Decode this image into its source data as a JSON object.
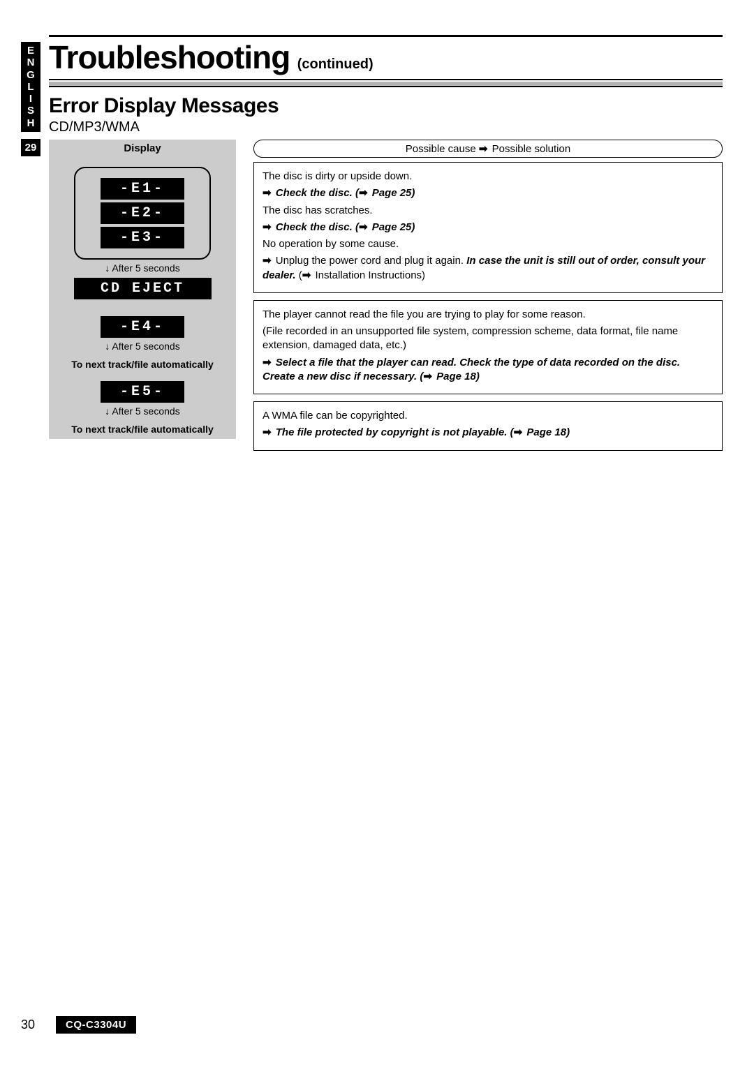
{
  "sidebar": {
    "language": "ENGLISH",
    "tab_page": "29"
  },
  "header": {
    "title": "Troubleshooting",
    "continued": "(continued)"
  },
  "section": {
    "heading": "Error Display Messages",
    "subtitle": "CD/MP3/WMA"
  },
  "left": {
    "header": "Display",
    "e1": "-E1-",
    "e2": "-E2-",
    "e3": "-E3-",
    "e4": "-E4-",
    "e5": "-E5-",
    "after5": "After 5 seconds",
    "cd_eject": "CD EJECT",
    "to_next": "To next track/file automatically"
  },
  "right": {
    "header_cause": "Possible cause",
    "header_sol": "Possible solution",
    "box1": {
      "l1": "The disc is dirty or upside down.",
      "l2a": "Check the disc. (",
      "l2b": " Page 25)",
      "l3": "The disc has scratches.",
      "l4a": "Check the disc. (",
      "l4b": " Page 25)",
      "l5": "No operation by some cause.",
      "l6a": "Unplug the power cord and plug it again. ",
      "l6b": "In case the unit is still out of order, consult your dealer.",
      "l6c": " (",
      "l6d": " Installation Instructions)"
    },
    "box2": {
      "l1": "The player cannot read the file you are trying to play for some reason.",
      "l2": "(File recorded in an unsupported file system, compression scheme, data format, file name extension, damaged data, etc.)",
      "l3a": "Select a file that the player can read. Check the type of data recorded on the disc. Create a new disc if necessary. (",
      "l3b": " Page 18)"
    },
    "box3": {
      "l1": "A WMA file can be copyrighted.",
      "l2a": "The file protected by copyright is not playable. (",
      "l2b": " Page 18)"
    }
  },
  "footer": {
    "page": "30",
    "model": "CQ-C3304U"
  },
  "glyphs": {
    "arrow": "➡"
  }
}
